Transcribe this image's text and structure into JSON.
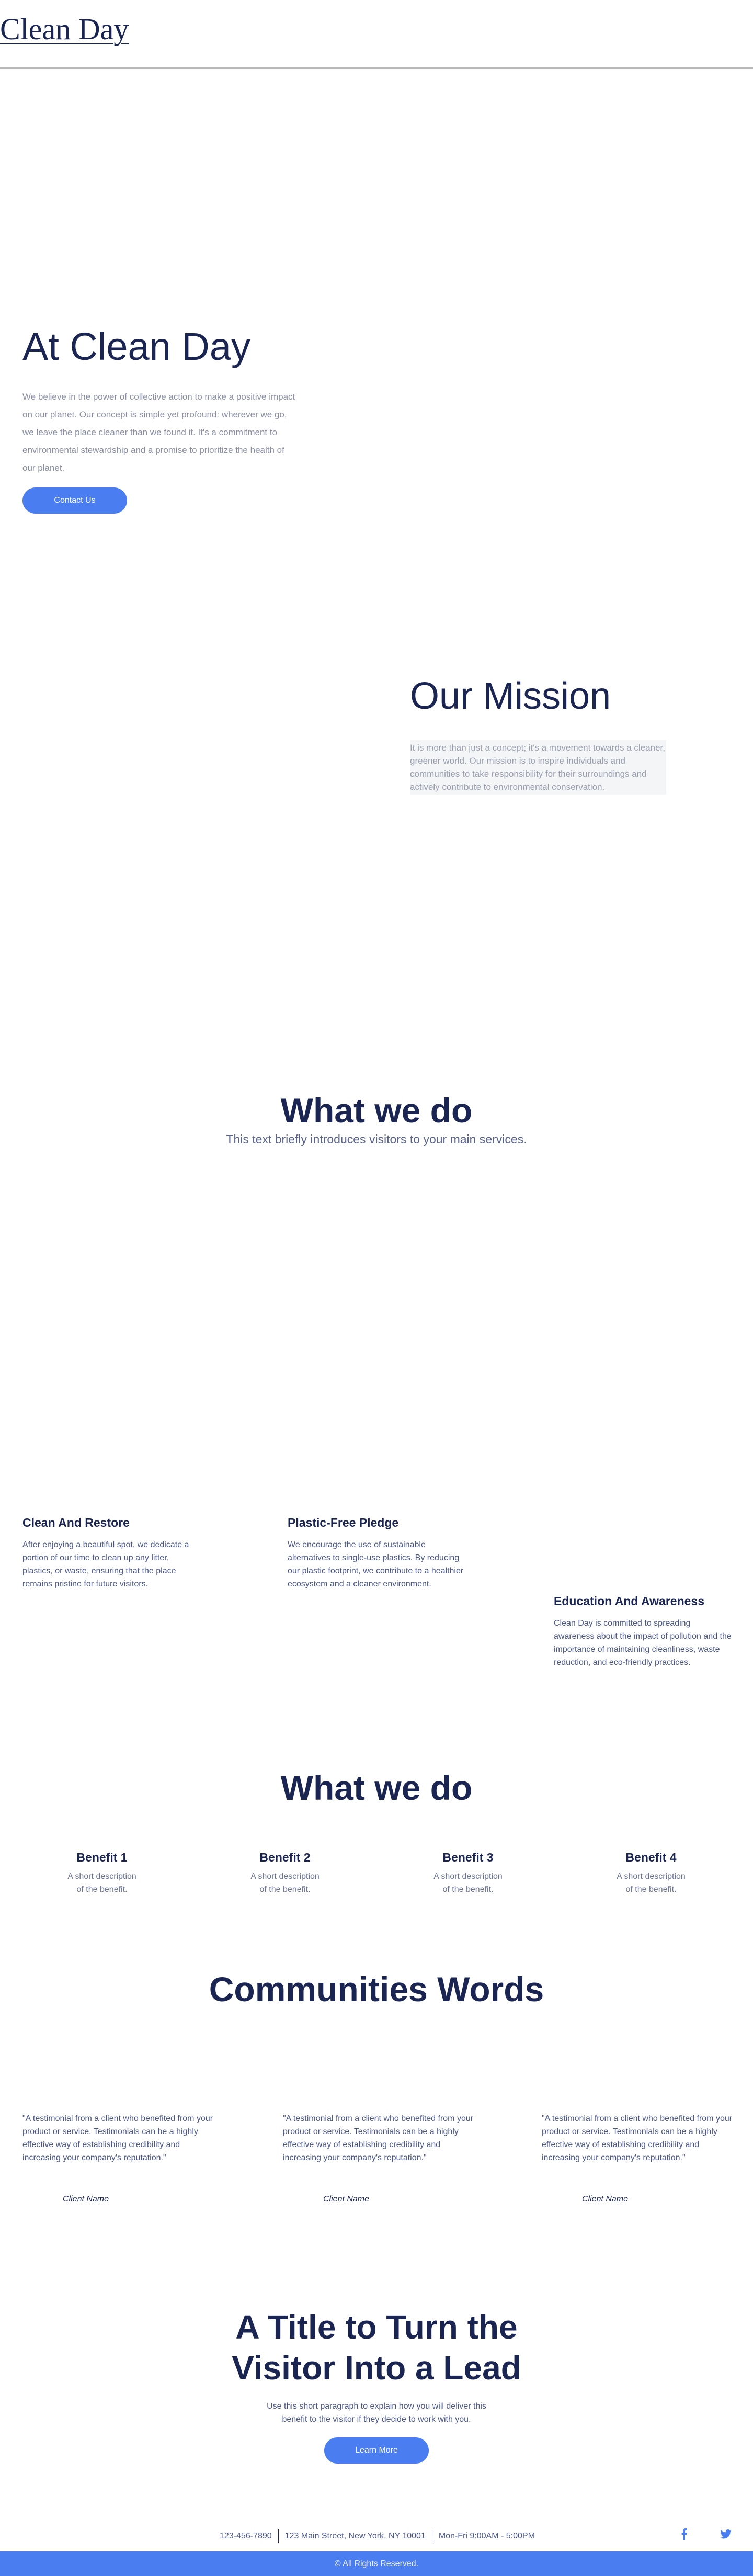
{
  "header": {
    "logo": "Clean Day"
  },
  "hero": {
    "title": "At Clean Day",
    "text": "We believe in the power of collective action to make a positive impact on our planet. Our concept is simple yet profound: wherever we go, we leave the place cleaner than we found it. It's a commitment to environmental stewardship and a promise to prioritize the health of our planet.",
    "button": "Contact Us"
  },
  "mission": {
    "title": "Our Mission",
    "text": "It is more than just a concept; it's a movement towards a cleaner, greener world. Our mission is to inspire individuals and communities to take responsibility for their surroundings and actively contribute to environmental conservation."
  },
  "what_we_do": {
    "title": "What we do",
    "subtitle": "This text briefly introduces visitors to your main services."
  },
  "services": [
    {
      "title": "Clean And Restore",
      "text": "After enjoying a beautiful spot, we dedicate a portion of our time to clean up any litter, plastics, or waste, ensuring that the place remains pristine for future visitors."
    },
    {
      "title": "Plastic-Free Pledge",
      "text": "We encourage the use of sustainable alternatives to single-use plastics. By reducing our plastic footprint, we contribute to a healthier ecosystem and a cleaner environment."
    },
    {
      "title": "Education And Awareness",
      "text": "Clean Day is committed to spreading awareness about the impact of pollution and the importance of maintaining cleanliness, waste reduction, and eco-friendly practices."
    }
  ],
  "benefits_section": {
    "title": "What we do"
  },
  "benefits": [
    {
      "title": "Benefit 1",
      "text": "A short description of the benefit."
    },
    {
      "title": "Benefit 2",
      "text": "A short description of the benefit."
    },
    {
      "title": "Benefit 3",
      "text": "A short description of the benefit."
    },
    {
      "title": "Benefit 4",
      "text": "A short description of the benefit."
    }
  ],
  "community": {
    "title": "Communities Words",
    "testimonials": [
      {
        "quote": "\"A testimonial from a client who benefited from your product or service. Testimonials can be a highly effective way of establishing credibility and increasing your company's reputation.\"",
        "client": "Client Name"
      },
      {
        "quote": "\"A testimonial from a client who benefited from your product or service. Testimonials can be a highly effective way of establishing credibility and increasing your company's reputation.\"",
        "client": "Client Name"
      },
      {
        "quote": "\"A testimonial from a client who benefited from your product or service. Testimonials can be a highly effective way of establishing credibility and increasing your company's reputation.\"",
        "client": "Client Name"
      }
    ]
  },
  "cta": {
    "title_line1": "A Title to Turn the",
    "title_line2": "Visitor Into a Lead",
    "text": "Use this short paragraph to explain how you will deliver this benefit to the visitor if they decide to work with you.",
    "button": "Learn More"
  },
  "footer": {
    "phone": "123-456-7890",
    "address": "123 Main Street, New York, NY 10001",
    "hours": "Mon-Fri 9:00AM - 5:00PM",
    "social_icons": [
      "facebook-icon",
      "twitter-icon"
    ],
    "copyright": "© All Rights Reserved."
  },
  "colors": {
    "accent": "#4a7df0",
    "heading": "#1b2552",
    "body_text": "#4a5788",
    "muted_text": "#8a8ea3"
  }
}
